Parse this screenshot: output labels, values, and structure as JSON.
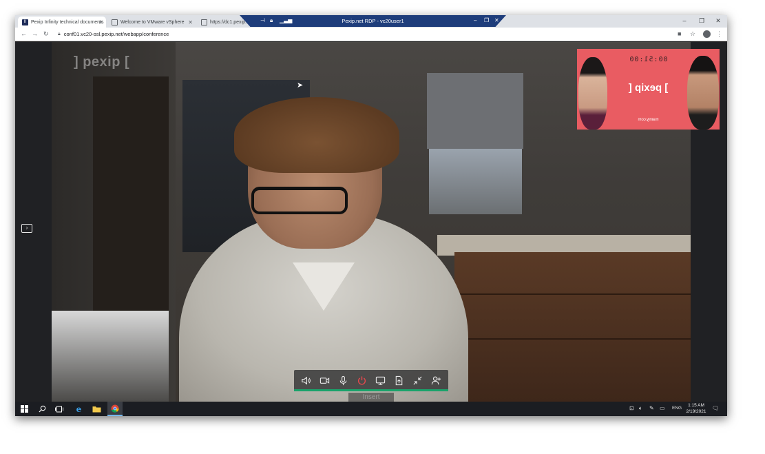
{
  "browser": {
    "tabs": [
      {
        "title": "Pexip Infinity technical documents",
        "icon": "pexip-favicon"
      },
      {
        "title": "Welcome to VMware vSphere",
        "icon": "globe-icon"
      },
      {
        "title": "https://dc1.pexip.",
        "icon": "globe-icon"
      }
    ],
    "url": "conf01.vc20-osl.pexip.net/webapp/conference"
  },
  "rdp": {
    "title": "Pexip.net RDP - vc20user1"
  },
  "conference": {
    "watermark": "] pexip [",
    "selfview": {
      "counter": "00:51:00",
      "logo": "] pexip [",
      "brand": "mainly.com"
    },
    "toolbar": {
      "caption": "Insert",
      "buttons": [
        {
          "name": "speaker",
          "icon": "speaker-icon"
        },
        {
          "name": "camera",
          "icon": "camera-icon"
        },
        {
          "name": "microphone",
          "icon": "microphone-icon"
        },
        {
          "name": "hang-up",
          "icon": "power-icon",
          "color": "#e5484d"
        },
        {
          "name": "share-screen",
          "icon": "monitor-icon"
        },
        {
          "name": "share-file",
          "icon": "file-upload-icon"
        },
        {
          "name": "minimize",
          "icon": "collapse-icon"
        },
        {
          "name": "add-participant",
          "icon": "add-user-icon"
        }
      ],
      "accent": "#1aa36b"
    }
  },
  "taskbar": {
    "tray_language": "ENG",
    "time": "1:15 AM",
    "date": "2/19/2021"
  }
}
